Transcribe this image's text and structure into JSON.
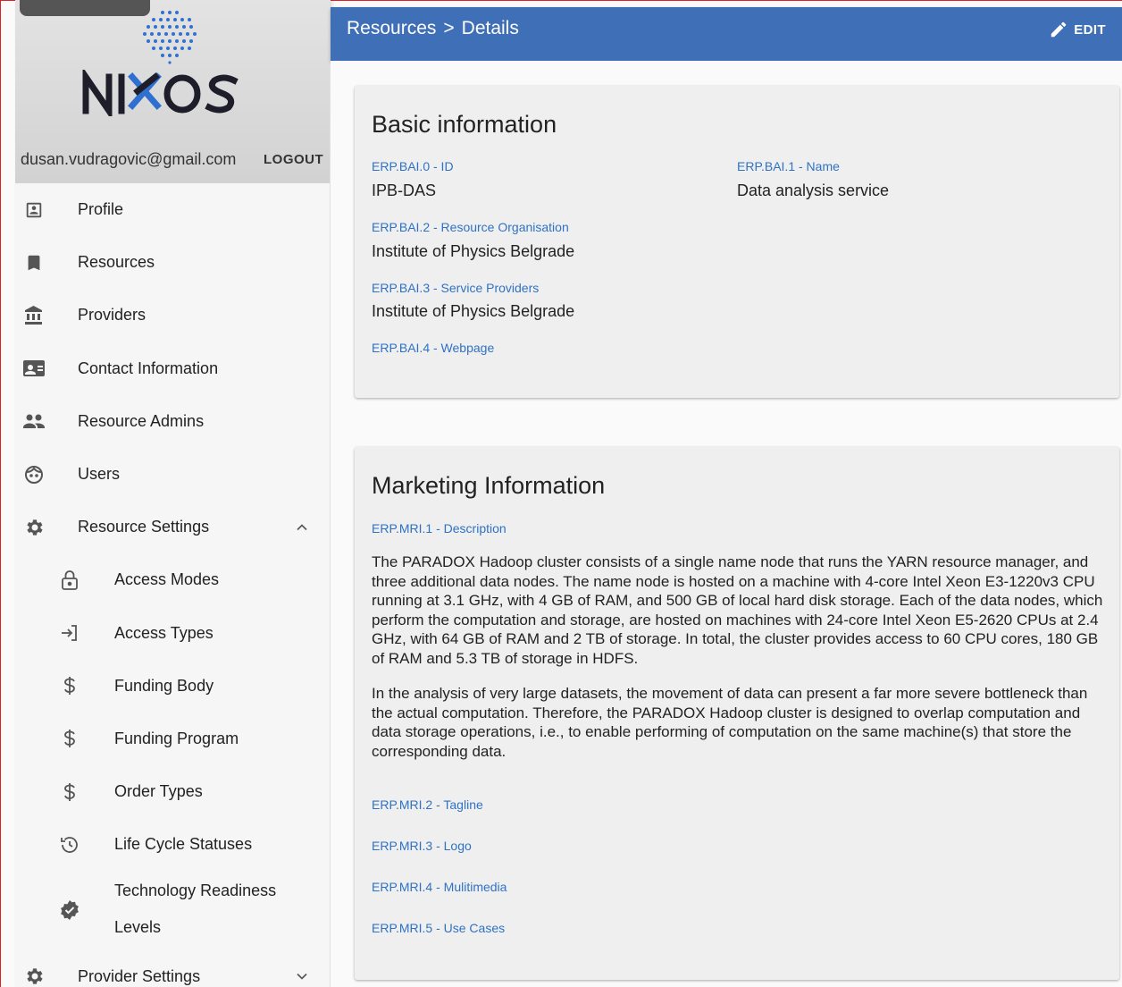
{
  "sidebar": {
    "user_email": "dusan.vudragovic@gmail.com",
    "logout_label": "LOGOUT",
    "items": [
      {
        "label": "Profile",
        "icon": "profile-icon"
      },
      {
        "label": "Resources",
        "icon": "bookmark-icon"
      },
      {
        "label": "Providers",
        "icon": "bank-icon"
      },
      {
        "label": "Contact Information",
        "icon": "contact-card-icon"
      },
      {
        "label": "Resource Admins",
        "icon": "people-icon"
      },
      {
        "label": "Users",
        "icon": "face-icon"
      },
      {
        "label": "Resource Settings",
        "icon": "gear-icon",
        "expanded": true
      },
      {
        "label": "Access Modes",
        "icon": "lock-icon"
      },
      {
        "label": "Access Types",
        "icon": "login-icon"
      },
      {
        "label": "Funding Body",
        "icon": "dollar-icon"
      },
      {
        "label": "Funding Program",
        "icon": "dollar-icon"
      },
      {
        "label": "Order Types",
        "icon": "dollar-icon"
      },
      {
        "label": "Life Cycle Statuses",
        "icon": "history-icon"
      },
      {
        "label": "Technology Readiness Levels",
        "icon": "verified-icon"
      },
      {
        "label": "Provider Settings",
        "icon": "gear-icon",
        "expanded": false
      }
    ]
  },
  "topbar": {
    "crumb_root": "Resources",
    "crumb_sep": ">",
    "crumb_current": "Details",
    "edit_label": "EDIT"
  },
  "basic": {
    "title": "Basic information",
    "id_label": "ERP.BAI.0 - ID",
    "id_value": "IPB-DAS",
    "name_label": "ERP.BAI.1 - Name",
    "name_value": "Data analysis service",
    "org_label": "ERP.BAI.2 - Resource Organisation",
    "org_value": "Institute of Physics Belgrade",
    "providers_label": "ERP.BAI.3 - Service Providers",
    "providers_value": "Institute of Physics Belgrade",
    "webpage_label": "ERP.BAI.4 - Webpage"
  },
  "marketing": {
    "title": "Marketing Information",
    "desc_label": "ERP.MRI.1 - Description",
    "desc_p1": "The PARADOX Hadoop cluster consists of a single name node that runs the YARN resource manager, and three additional data nodes. The name node is hosted on a machine with 4-core Intel Xeon E3-1220v3 CPU running at 3.1 GHz, with 4 GB of RAM, and 500 GB of local hard disk storage. Each of the data nodes, which perform the computation and storage, are hosted on machines with 24-core Intel Xeon E5-2620 CPUs at 2.4 GHz, with 64 GB of RAM and 2 TB of storage. In total, the cluster provides access to 60 CPU cores, 180 GB of RAM and 5.3 TB of storage in HDFS.",
    "desc_p2": "In the analysis of very large datasets, the movement of data can present a far more severe bottleneck than the actual computation. Therefore, the PARADOX Hadoop cluster is designed to overlap computation and data storage operations, i.e., to enable performing of computation on the same machine(s) that store the corresponding data.",
    "tagline_label": "ERP.MRI.2 - Tagline",
    "logo_label": "ERP.MRI.3 - Logo",
    "multimedia_label": "ERP.MRI.4 - Mulitimedia",
    "usecases_label": "ERP.MRI.5 - Use Cases"
  },
  "colors": {
    "topbar": "#3f6fb6",
    "link_label": "#2f72c4",
    "logo_dark": "#1e1e2a",
    "logo_blue": "#2f6fd0"
  }
}
